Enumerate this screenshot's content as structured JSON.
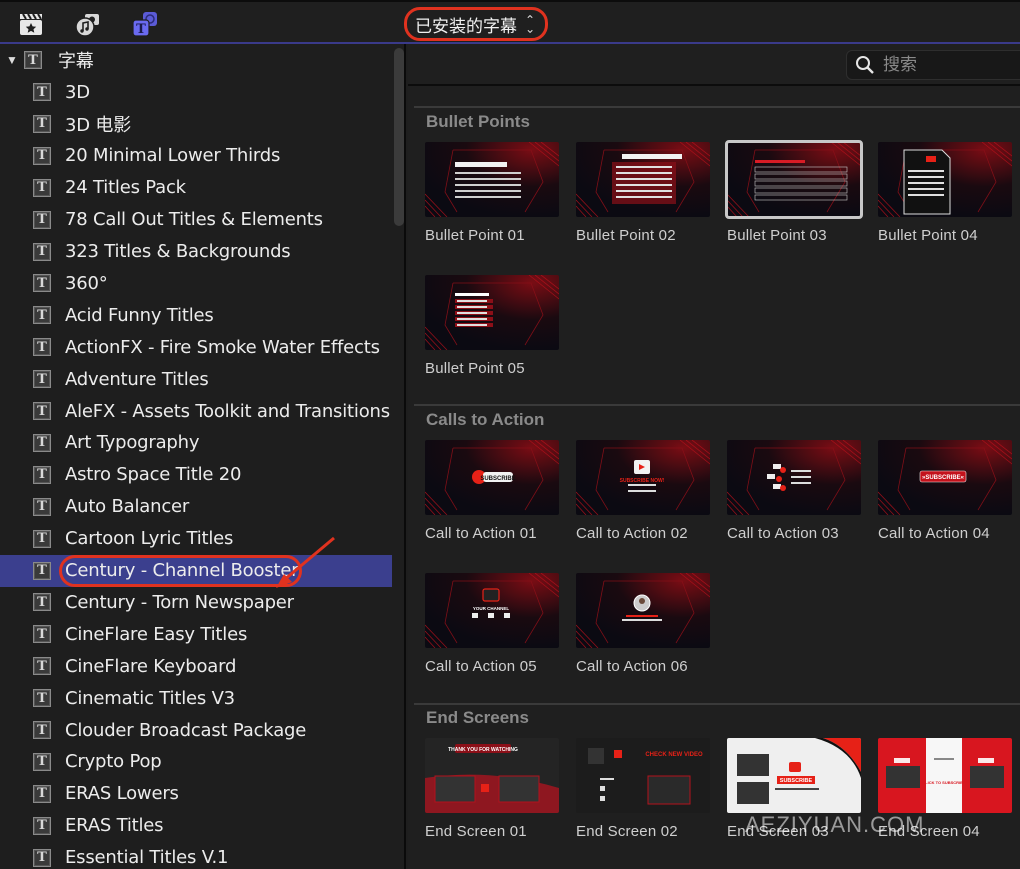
{
  "toolbar": {
    "icons": [
      {
        "name": "photos-videos-icon",
        "label": "Photos and Videos"
      },
      {
        "name": "music-sound-icon",
        "label": "Music and Sound"
      },
      {
        "name": "titles-generators-icon",
        "label": "Titles and Generators",
        "active": true
      }
    ],
    "library_selector": "已安装的字幕",
    "accent_color": "#5b5bd6",
    "annotation_color": "#e0321f"
  },
  "sidebar": {
    "root": {
      "label": "字幕",
      "expanded": true
    },
    "items": [
      {
        "label": "3D"
      },
      {
        "label": "3D 电影"
      },
      {
        "label": "20 Minimal Lower Thirds"
      },
      {
        "label": "24 Titles Pack"
      },
      {
        "label": "78 Call Out Titles & Elements"
      },
      {
        "label": "323 Titles & Backgrounds"
      },
      {
        "label": "360°"
      },
      {
        "label": "Acid Funny Titles"
      },
      {
        "label": "ActionFX - Fire Smoke Water Effects"
      },
      {
        "label": "Adventure Titles"
      },
      {
        "label": "AleFX - Assets Toolkit and Transitions"
      },
      {
        "label": "Art Typography"
      },
      {
        "label": "Astro Space Title 20"
      },
      {
        "label": "Auto Balancer"
      },
      {
        "label": "Cartoon Lyric Titles"
      },
      {
        "label": "Century - Channel Booster",
        "selected": true
      },
      {
        "label": "Century - Torn Newspaper"
      },
      {
        "label": "CineFlare Easy Titles"
      },
      {
        "label": "CineFlare Keyboard"
      },
      {
        "label": "Cinematic Titles V3"
      },
      {
        "label": "Clouder Broadcast Package"
      },
      {
        "label": "Crypto Pop"
      },
      {
        "label": "ERAS Lowers"
      },
      {
        "label": "ERAS Titles"
      },
      {
        "label": "Essential Titles V.1"
      }
    ],
    "selected_color": "#3b3f8e"
  },
  "browser": {
    "search": {
      "placeholder": "搜索",
      "value": ""
    },
    "sections": [
      {
        "title": "Bullet Points",
        "clips": [
          {
            "name": "Bullet Point 01",
            "style": "bullet-white"
          },
          {
            "name": "Bullet Point 02",
            "style": "bullet-red"
          },
          {
            "name": "Bullet Point 03",
            "style": "bullet-outline",
            "selected": true
          },
          {
            "name": "Bullet Point 04",
            "style": "bullet-paper"
          },
          {
            "name": "Bullet Point 05",
            "style": "bullet-list"
          }
        ]
      },
      {
        "title": "Calls to Action",
        "clips": [
          {
            "name": "Call to Action 01",
            "style": "cta-bell",
            "caption": "SUBSCRIBE"
          },
          {
            "name": "Call to Action 02",
            "style": "cta-play",
            "caption": "SUBSCRIBE NOW!"
          },
          {
            "name": "Call to Action 03",
            "style": "cta-chat"
          },
          {
            "name": "Call to Action 04",
            "style": "cta-button",
            "caption": "»SUBSCRIBE«"
          },
          {
            "name": "Call to Action 05",
            "style": "cta-socials",
            "caption": "YOUR CHANNEL"
          },
          {
            "name": "Call to Action 06",
            "style": "cta-avatar"
          }
        ]
      },
      {
        "title": "End Screens",
        "clips": [
          {
            "name": "End Screen 01",
            "style": "end-thanks",
            "caption": "THANK YOU FOR WATCHING"
          },
          {
            "name": "End Screen 02",
            "style": "end-dark",
            "caption": "CHECK NEW VIDEO"
          },
          {
            "name": "End Screen 03",
            "style": "end-white",
            "caption": "SUBSCRIBE"
          },
          {
            "name": "End Screen 04",
            "style": "end-red",
            "caption": "CLICK TO SUBSCRIBE"
          }
        ]
      }
    ]
  },
  "watermark": "AEZIYUAN.COM"
}
